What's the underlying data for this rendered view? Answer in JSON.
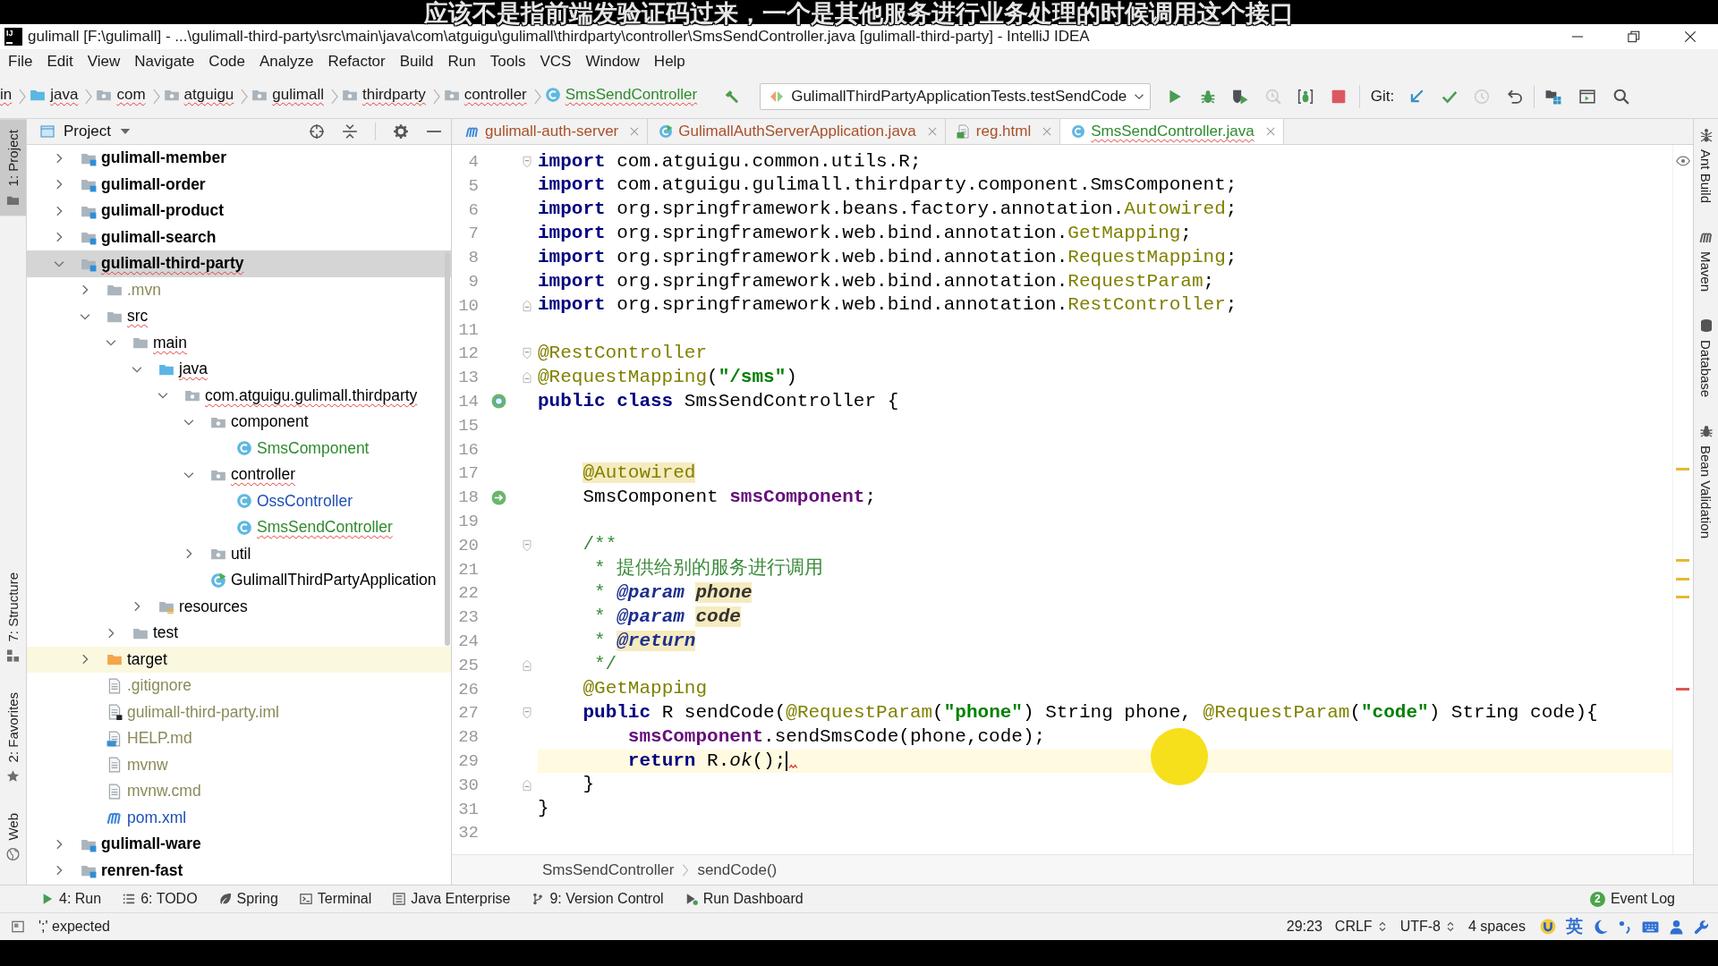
{
  "subtitle": "应该不是指前端发验证码过来，一个是其他服务进行业务处理的时候调用这个接口",
  "window": {
    "logo": "IJ",
    "title": "gulimall [F:\\gulimall] - ...\\gulimall-third-party\\src\\main\\java\\com\\atguigu\\gulimall\\thirdparty\\controller\\SmsSendController.java [gulimall-third-party] - IntelliJ IDEA"
  },
  "menu": [
    "File",
    "Edit",
    "View",
    "Navigate",
    "Code",
    "Analyze",
    "Refactor",
    "Build",
    "Run",
    "Tools",
    "VCS",
    "Window",
    "Help"
  ],
  "navigation": {
    "breadcrumbs": [
      {
        "label": "in",
        "kind": "none",
        "color": "#1a1a1a",
        "errors": true
      },
      {
        "label": "java",
        "kind": "source-folder",
        "color": "#1a1a1a",
        "errors": true
      },
      {
        "label": "com",
        "kind": "package",
        "color": "#1a1a1a",
        "errors": true
      },
      {
        "label": "atguigu",
        "kind": "package",
        "color": "#1a1a1a",
        "errors": true
      },
      {
        "label": "gulimall",
        "kind": "package",
        "color": "#1a1a1a",
        "errors": true
      },
      {
        "label": "thirdparty",
        "kind": "package",
        "color": "#1a1a1a",
        "errors": true
      },
      {
        "label": "controller",
        "kind": "package",
        "color": "#1a1a1a",
        "errors": true
      },
      {
        "label": "SmsSendController",
        "kind": "class",
        "color": "#2e8b2e",
        "errors": true
      }
    ]
  },
  "toolbar": {
    "build": {
      "kind": "build",
      "disabled": false
    },
    "run_configuration": "GulimallThirdPartyApplicationTests.testSendCode",
    "actions": [
      {
        "kind": "run",
        "disabled": false
      },
      {
        "kind": "debug",
        "disabled": false
      },
      {
        "kind": "coverage",
        "disabled": false
      },
      {
        "kind": "profile",
        "disabled": true
      },
      {
        "kind": "attach-debugger",
        "disabled": false
      },
      {
        "kind": "stop",
        "disabled": false
      }
    ],
    "vcs_label": "Git:",
    "vcs_actions": [
      {
        "kind": "update",
        "disabled": false
      },
      {
        "kind": "commit",
        "disabled": false
      },
      {
        "kind": "history",
        "disabled": true
      },
      {
        "kind": "rollback",
        "disabled": false
      }
    ],
    "extra_actions": [
      {
        "kind": "project-structure",
        "disabled": false
      },
      {
        "kind": "window",
        "disabled": false
      },
      {
        "kind": "search",
        "disabled": false
      }
    ]
  },
  "tool_strips": {
    "left_top": [
      {
        "label": "1: Project",
        "kind": "project",
        "selected": true
      }
    ],
    "left_bottom": [
      {
        "label": "7: Structure",
        "kind": "structure",
        "selected": false
      },
      {
        "label": "2: Favorites",
        "kind": "favorites",
        "selected": false
      },
      {
        "label": "Web",
        "kind": "web",
        "selected": false
      }
    ],
    "right": [
      {
        "label": "Ant Build",
        "kind": "ant",
        "selected": false
      },
      {
        "label": "Maven",
        "kind": "maven",
        "selected": false
      },
      {
        "label": "Database",
        "kind": "database",
        "selected": false
      },
      {
        "label": "Bean Validation",
        "kind": "bean-validation",
        "selected": false
      }
    ]
  },
  "project_panel": {
    "title": "Project",
    "tree": [
      {
        "label": "gulimall-member",
        "kind": "module",
        "color": "#000000",
        "errors": false,
        "selected": false,
        "expanded": false
      },
      {
        "label": "gulimall-order",
        "kind": "module",
        "color": "#000000",
        "errors": false,
        "selected": false,
        "expanded": false
      },
      {
        "label": "gulimall-product",
        "kind": "module",
        "color": "#000000",
        "errors": false,
        "selected": false,
        "expanded": false
      },
      {
        "label": "gulimall-search",
        "kind": "module",
        "color": "#000000",
        "errors": false,
        "selected": false,
        "expanded": false
      },
      {
        "label": "gulimall-third-party",
        "kind": "module",
        "color": "#000000",
        "errors": true,
        "selected": true,
        "expanded": true,
        "children": [
          {
            "label": ".mvn",
            "kind": "folder",
            "color": "#8a8a58",
            "errors": false,
            "selected": false,
            "expanded": false
          },
          {
            "label": "src",
            "kind": "folder",
            "color": "#000000",
            "errors": true,
            "selected": false,
            "expanded": true,
            "children": [
              {
                "label": "main",
                "kind": "folder",
                "color": "#000000",
                "errors": true,
                "selected": false,
                "expanded": true,
                "children": [
                  {
                    "label": "java",
                    "kind": "source-folder",
                    "color": "#000000",
                    "errors": true,
                    "selected": false,
                    "expanded": true,
                    "children": [
                      {
                        "label": "com.atguigu.gulimall.thirdparty",
                        "kind": "package",
                        "color": "#000000",
                        "errors": true,
                        "selected": false,
                        "expanded": true,
                        "children": [
                          {
                            "label": "component",
                            "kind": "package",
                            "color": "#000000",
                            "errors": false,
                            "selected": false,
                            "expanded": true,
                            "children": [
                              {
                                "label": "SmsComponent",
                                "kind": "class",
                                "color": "#2e8b2e",
                                "errors": false,
                                "selected": false
                              }
                            ]
                          },
                          {
                            "label": "controller",
                            "kind": "package",
                            "color": "#000000",
                            "errors": true,
                            "selected": false,
                            "expanded": true,
                            "children": [
                              {
                                "label": "OssController",
                                "kind": "class",
                                "color": "#1f4fb5",
                                "errors": false,
                                "selected": false
                              },
                              {
                                "label": "SmsSendController",
                                "kind": "class",
                                "color": "#2e8b2e",
                                "errors": true,
                                "selected": false
                              }
                            ]
                          },
                          {
                            "label": "util",
                            "kind": "package",
                            "color": "#000000",
                            "errors": false,
                            "selected": false,
                            "expanded": false
                          },
                          {
                            "label": "GulimallThirdPartyApplication",
                            "kind": "application",
                            "color": "#000000",
                            "errors": false,
                            "selected": false
                          }
                        ]
                      }
                    ]
                  },
                  {
                    "label": "resources",
                    "kind": "resources-folder",
                    "color": "#000000",
                    "errors": false,
                    "selected": false,
                    "expanded": false
                  }
                ]
              },
              {
                "label": "test",
                "kind": "folder",
                "color": "#000000",
                "errors": false,
                "selected": false,
                "expanded": false
              }
            ]
          },
          {
            "label": "target",
            "kind": "excluded-folder",
            "color": "#000000",
            "errors": false,
            "selected": false,
            "expanded": false
          },
          {
            "label": ".gitignore",
            "kind": "text-file",
            "color": "#8a8a58",
            "errors": false,
            "selected": false
          },
          {
            "label": "gulimall-third-party.iml",
            "kind": "iml-file",
            "color": "#8a8a58",
            "errors": false,
            "selected": false
          },
          {
            "label": "HELP.md",
            "kind": "markdown-file",
            "color": "#8a8a58",
            "errors": false,
            "selected": false
          },
          {
            "label": "mvnw",
            "kind": "text-file",
            "color": "#8a8a58",
            "errors": false,
            "selected": false
          },
          {
            "label": "mvnw.cmd",
            "kind": "text-file",
            "color": "#8a8a58",
            "errors": false,
            "selected": false
          },
          {
            "label": "pom.xml",
            "kind": "maven-file",
            "color": "#1f4fb5",
            "errors": false,
            "selected": false
          }
        ]
      },
      {
        "label": "gulimall-ware",
        "kind": "module",
        "color": "#000000",
        "errors": false,
        "selected": false,
        "expanded": false
      },
      {
        "label": "renren-fast",
        "kind": "module",
        "color": "#000000",
        "errors": false,
        "selected": false,
        "expanded": false
      }
    ]
  },
  "editor": {
    "tabs": [
      {
        "label": "gulimall-auth-server",
        "kind": "maven-file",
        "color": "#a8502a",
        "errors": false,
        "selected": false
      },
      {
        "label": "GulimallAuthServerApplication.java",
        "kind": "application",
        "color": "#a8502a",
        "errors": false,
        "selected": false
      },
      {
        "label": "reg.html",
        "kind": "html-file",
        "color": "#a8502a",
        "errors": false,
        "selected": false
      },
      {
        "label": "SmsSendController.java",
        "kind": "class",
        "color": "#2e8b2e",
        "errors": true,
        "selected": true
      }
    ],
    "lines": [
      {
        "number": "4",
        "current": false,
        "fold_start": true,
        "tokens": [
          {
            "kind": "keyword",
            "text": "import"
          },
          {
            "kind": "plain",
            "text": " com.atguigu.common.utils.R;"
          }
        ]
      },
      {
        "number": "5",
        "current": false,
        "tokens": [
          {
            "kind": "keyword",
            "text": "import"
          },
          {
            "kind": "plain",
            "text": " com.atguigu.gulimall.thirdparty.component.SmsComponent;"
          }
        ]
      },
      {
        "number": "6",
        "current": false,
        "tokens": [
          {
            "kind": "keyword",
            "text": "import"
          },
          {
            "kind": "plain",
            "text": " org.springframework.beans.factory.annotation."
          },
          {
            "kind": "annotation",
            "text": "Autowired"
          },
          {
            "kind": "plain",
            "text": ";"
          }
        ]
      },
      {
        "number": "7",
        "current": false,
        "tokens": [
          {
            "kind": "keyword",
            "text": "import"
          },
          {
            "kind": "plain",
            "text": " org.springframework.web.bind.annotation."
          },
          {
            "kind": "annotation",
            "text": "GetMapping"
          },
          {
            "kind": "plain",
            "text": ";"
          }
        ]
      },
      {
        "number": "8",
        "current": false,
        "tokens": [
          {
            "kind": "keyword",
            "text": "import"
          },
          {
            "kind": "plain",
            "text": " org.springframework.web.bind.annotation."
          },
          {
            "kind": "annotation",
            "text": "RequestMapping"
          },
          {
            "kind": "plain",
            "text": ";"
          }
        ]
      },
      {
        "number": "9",
        "current": false,
        "tokens": [
          {
            "kind": "keyword",
            "text": "import"
          },
          {
            "kind": "plain",
            "text": " org.springframework.web.bind.annotation."
          },
          {
            "kind": "annotation",
            "text": "RequestParam"
          },
          {
            "kind": "plain",
            "text": ";"
          }
        ]
      },
      {
        "number": "10",
        "current": false,
        "fold_end": true,
        "tokens": [
          {
            "kind": "keyword",
            "text": "import"
          },
          {
            "kind": "plain",
            "text": " org.springframework.web.bind.annotation."
          },
          {
            "kind": "annotation",
            "text": "RestController"
          },
          {
            "kind": "plain",
            "text": ";"
          }
        ]
      },
      {
        "number": "11",
        "current": false
      },
      {
        "number": "12",
        "current": false,
        "fold_start": true,
        "tokens": [
          {
            "kind": "annotation",
            "text": "@RestController"
          }
        ]
      },
      {
        "number": "13",
        "current": false,
        "fold_end": true,
        "tokens": [
          {
            "kind": "annotation",
            "text": "@RequestMapping"
          },
          {
            "kind": "plain",
            "text": "("
          },
          {
            "kind": "string",
            "text": "\"/sms\""
          },
          {
            "kind": "plain",
            "text": ")"
          }
        ]
      },
      {
        "number": "14",
        "current": false,
        "gutter_icon": {
          "kind": "bean"
        },
        "tokens": [
          {
            "kind": "keyword",
            "text": "public class"
          },
          {
            "kind": "plain",
            "text": " SmsSendController {"
          }
        ]
      },
      {
        "number": "15",
        "current": false
      },
      {
        "number": "16",
        "current": false
      },
      {
        "number": "17",
        "current": false,
        "inspection": {
          "kind": "warning"
        },
        "tokens": [
          {
            "kind": "annotation",
            "text": "    @Autowired",
            "warning": true
          }
        ]
      },
      {
        "number": "18",
        "current": false,
        "gutter_icon": {
          "kind": "injection"
        },
        "tokens": [
          {
            "kind": "plain",
            "text": "    SmsComponent "
          },
          {
            "kind": "field",
            "text": "smsComponent"
          },
          {
            "kind": "plain",
            "text": ";"
          }
        ]
      },
      {
        "number": "19",
        "current": false
      },
      {
        "number": "20",
        "current": false,
        "fold_start": true,
        "tokens": [
          {
            "kind": "comment",
            "text": "    /**"
          }
        ]
      },
      {
        "number": "21",
        "current": false,
        "tokens": [
          {
            "kind": "comment",
            "text": "     * 提供给别的服务进行调用"
          }
        ]
      },
      {
        "number": "22",
        "current": false,
        "inspection": {
          "kind": "warning"
        },
        "tokens": [
          {
            "kind": "comment",
            "text": "     * "
          },
          {
            "kind": "doc-tag",
            "text": "@param"
          },
          {
            "kind": "doc-value",
            "text": " phone",
            "warning": true
          }
        ]
      },
      {
        "number": "23",
        "current": false,
        "inspection": {
          "kind": "warning"
        },
        "tokens": [
          {
            "kind": "comment",
            "text": "     * "
          },
          {
            "kind": "doc-tag",
            "text": "@param"
          },
          {
            "kind": "doc-value",
            "text": " code",
            "warning": true
          }
        ]
      },
      {
        "number": "24",
        "current": false,
        "inspection": {
          "kind": "warning"
        },
        "tokens": [
          {
            "kind": "comment",
            "text": "     * "
          },
          {
            "kind": "doc-tag",
            "text": "@return",
            "warning": true
          }
        ]
      },
      {
        "number": "25",
        "current": false,
        "fold_end": true,
        "tokens": [
          {
            "kind": "comment",
            "text": "     */"
          }
        ]
      },
      {
        "number": "26",
        "current": false,
        "tokens": [
          {
            "kind": "annotation",
            "text": "    @GetMapping"
          }
        ]
      },
      {
        "number": "27",
        "current": false,
        "fold_start": true,
        "tokens": [
          {
            "kind": "keyword",
            "text": "    public"
          },
          {
            "kind": "plain",
            "text": " R sendCode("
          },
          {
            "kind": "annotation",
            "text": "@RequestParam"
          },
          {
            "kind": "plain",
            "text": "("
          },
          {
            "kind": "string",
            "text": "\"phone\""
          },
          {
            "kind": "plain",
            "text": ") String phone, "
          },
          {
            "kind": "annotation",
            "text": "@RequestParam"
          },
          {
            "kind": "plain",
            "text": "("
          },
          {
            "kind": "string",
            "text": "\"code\""
          },
          {
            "kind": "plain",
            "text": ") String code){"
          }
        ]
      },
      {
        "number": "28",
        "current": false,
        "tokens": [
          {
            "kind": "field",
            "text": "        smsComponent"
          },
          {
            "kind": "plain",
            "text": ".sendSmsCode(phone,code);"
          }
        ]
      },
      {
        "number": "29",
        "current": true,
        "inspection": {
          "kind": "error"
        },
        "tokens": [
          {
            "kind": "keyword",
            "text": "        return"
          },
          {
            "kind": "plain",
            "text": " R."
          },
          {
            "kind": "static-call",
            "text": "ok"
          },
          {
            "kind": "plain",
            "text": "();"
          }
        ]
      },
      {
        "number": "30",
        "current": false,
        "fold_end": true,
        "tokens": [
          {
            "kind": "plain",
            "text": "    }"
          }
        ]
      },
      {
        "number": "31",
        "current": false,
        "tokens": [
          {
            "kind": "plain",
            "text": "}"
          }
        ]
      },
      {
        "number": "32",
        "current": false
      }
    ],
    "breadcrumbs": [
      "SmsSendController",
      "sendCode()"
    ]
  },
  "tool_window_bar": {
    "left": [
      {
        "label": "4: Run",
        "kind": "run"
      },
      {
        "label": "6: TODO",
        "kind": "todo"
      },
      {
        "label": "Spring",
        "kind": "spring"
      },
      {
        "label": "Terminal",
        "kind": "terminal"
      },
      {
        "label": "Java Enterprise",
        "kind": "java-enterprise"
      },
      {
        "label": "9: Version Control",
        "kind": "version-control"
      },
      {
        "label": "Run Dashboard",
        "kind": "run-dashboard"
      }
    ],
    "right": [
      {
        "label": "Event Log",
        "badge": "2"
      }
    ]
  },
  "status_bar": {
    "message": "';' expected",
    "position": "29:23",
    "line_separator": "CRLF",
    "encoding": "UTF-8",
    "indent": "4 spaces",
    "input_method": "英"
  }
}
